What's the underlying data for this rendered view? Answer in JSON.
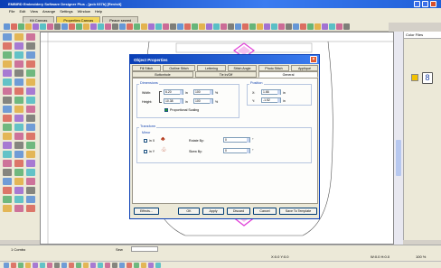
{
  "app": {
    "title": "EMBIRD Embroidery Software Designer Plus - [pcb 037b] [Revisit]"
  },
  "menu": [
    "File",
    "Edit",
    "View",
    "Arrange",
    "Settings",
    "Window",
    "Help"
  ],
  "doc_tabs": [
    {
      "label": "Kit Canvas",
      "active": false
    },
    {
      "label": "Properties Canvas",
      "active": true
    },
    {
      "label": "Peace sewed",
      "active": false
    }
  ],
  "right_panel": {
    "title": "Color Files"
  },
  "dialog": {
    "title": "Object Properties",
    "close_icon": "close-icon",
    "tabs_row1": [
      "Fill Stitch",
      "Outline Stitch",
      "Lettering",
      "Stitch Angle",
      "Photo Stitch",
      "Appliqué"
    ],
    "tabs_row2": [
      "Buttonhole",
      "Tie In/Off",
      "General"
    ],
    "active_tab": "General",
    "dimensions": {
      "label": "Dimensions",
      "width_label": "Width:",
      "width_value": "6.20",
      "width_unit": "in",
      "width_pct": "100",
      "height_label": "Height:",
      "height_value": "10.38",
      "height_unit": "in",
      "height_pct": "100",
      "pct_unit": "%",
      "proportional_label": "Proportional Scaling",
      "proportional_checked": true
    },
    "position": {
      "label": "Position",
      "x_label": "X:",
      "x_value": "1.66",
      "y_label": "Y:",
      "y_value": "-1.52",
      "unit": "in"
    },
    "transform": {
      "label": "Transform",
      "mirror_label": "Mirror",
      "mirror_x_label": "in X",
      "mirror_y_label": "in Y",
      "rotate_label": "Rotate By:",
      "rotate_value": "0",
      "skew_label": "Skew By:",
      "skew_value": "0",
      "deg_unit": "°"
    },
    "buttons": [
      "Effects...",
      "OK",
      "Apply",
      "Discard",
      "Cancel",
      "Save To Template"
    ]
  },
  "status": {
    "bottom_left": "1 Combo",
    "mode": "Sew",
    "coords": "X:0.0 Y:0.0",
    "size": "W:0.0 H:0.0",
    "zoom": "100 %"
  },
  "colors": {
    "accent": "#0a3fb5",
    "motif": "#e040d8"
  }
}
